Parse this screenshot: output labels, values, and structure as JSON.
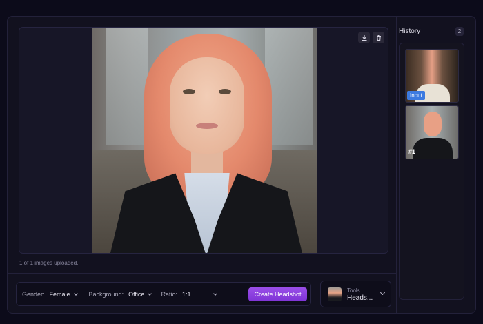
{
  "viewer": {
    "download_icon": "download-icon",
    "delete_icon": "trash-icon"
  },
  "upload_note": "1 of 1 images uploaded.",
  "controls": {
    "gender_label": "Gender:",
    "gender_value": "Female",
    "background_label": "Background:",
    "background_value": "Office",
    "ratio_label": "Ratio:",
    "ratio_value": "1:1",
    "create_button": "Create Headshot"
  },
  "tools": {
    "label": "Tools",
    "value": "Heads..."
  },
  "history": {
    "title": "History",
    "count": "2",
    "items": [
      {
        "badge": "Input"
      },
      {
        "badge": "#1"
      }
    ]
  },
  "colors": {
    "accent": "#8b3fe0",
    "input_badge": "#3c7ae0",
    "background": "#0c0b1a"
  }
}
